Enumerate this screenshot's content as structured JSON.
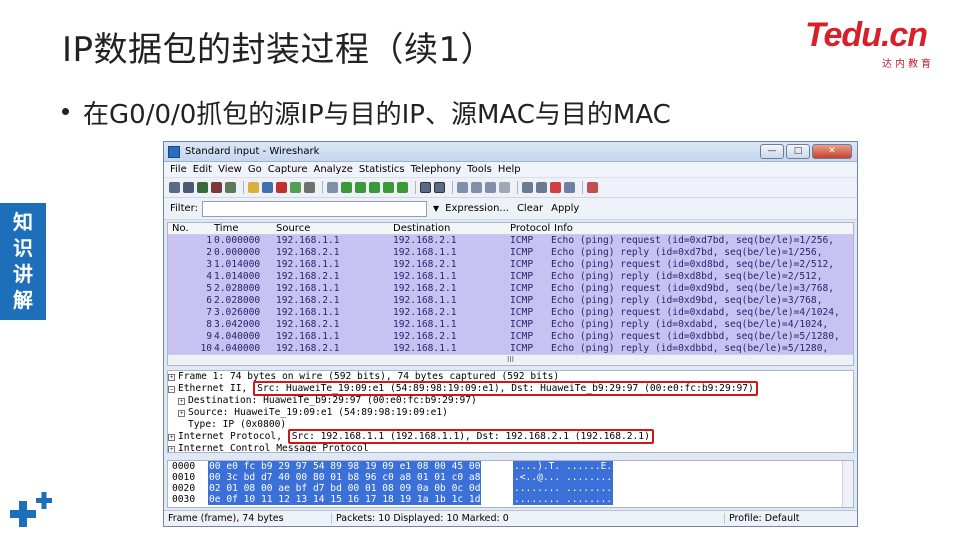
{
  "slide": {
    "title": "IP数据包的封装过程（续1）",
    "bullet": "在G0/0/0抓包的源IP与目的IP、源MAC与目的MAC",
    "side_tab": [
      "知",
      "识",
      "讲",
      "解"
    ],
    "logo_main": "Tedu.cn",
    "logo_sub": "达内教育",
    "accent_color": "#1c6fb8",
    "logo_color": "#d6202a"
  },
  "window": {
    "title": "Standard input - Wireshark",
    "controls": {
      "minimize": "—",
      "maximize": "□",
      "close": "✕"
    },
    "menu": [
      "File",
      "Edit",
      "View",
      "Go",
      "Capture",
      "Analyze",
      "Statistics",
      "Telephony",
      "Tools",
      "Help"
    ],
    "filter": {
      "label": "Filter:",
      "value": "",
      "dropdown": "▼",
      "expression": "Expression...",
      "clear": "Clear",
      "apply": "Apply"
    },
    "packet_list": {
      "columns": [
        "No.",
        "Time",
        "Source",
        "Destination",
        "Protocol",
        "Info"
      ],
      "rows": [
        {
          "no": "1",
          "time": "0.000000",
          "src": "192.168.1.1",
          "dst": "192.168.2.1",
          "proto": "ICMP",
          "info": "Echo (ping) request  (id=0xd7bd, seq(be/le)=1/256,"
        },
        {
          "no": "2",
          "time": "0.000000",
          "src": "192.168.2.1",
          "dst": "192.168.1.1",
          "proto": "ICMP",
          "info": "Echo (ping) reply    (id=0xd7bd, seq(be/le)=1/256,"
        },
        {
          "no": "3",
          "time": "1.014000",
          "src": "192.168.1.1",
          "dst": "192.168.2.1",
          "proto": "ICMP",
          "info": "Echo (ping) request  (id=0xd8bd, seq(be/le)=2/512,"
        },
        {
          "no": "4",
          "time": "1.014000",
          "src": "192.168.2.1",
          "dst": "192.168.1.1",
          "proto": "ICMP",
          "info": "Echo (ping) reply    (id=0xd8bd, seq(be/le)=2/512,"
        },
        {
          "no": "5",
          "time": "2.028000",
          "src": "192.168.1.1",
          "dst": "192.168.2.1",
          "proto": "ICMP",
          "info": "Echo (ping) request  (id=0xd9bd, seq(be/le)=3/768,"
        },
        {
          "no": "6",
          "time": "2.028000",
          "src": "192.168.2.1",
          "dst": "192.168.1.1",
          "proto": "ICMP",
          "info": "Echo (ping) reply    (id=0xd9bd, seq(be/le)=3/768,"
        },
        {
          "no": "7",
          "time": "3.026000",
          "src": "192.168.1.1",
          "dst": "192.168.2.1",
          "proto": "ICMP",
          "info": "Echo (ping) request  (id=0xdabd, seq(be/le)=4/1024,"
        },
        {
          "no": "8",
          "time": "3.042000",
          "src": "192.168.2.1",
          "dst": "192.168.1.1",
          "proto": "ICMP",
          "info": "Echo (ping) reply    (id=0xdabd, seq(be/le)=4/1024,"
        },
        {
          "no": "9",
          "time": "4.040000",
          "src": "192.168.1.1",
          "dst": "192.168.2.1",
          "proto": "ICMP",
          "info": "Echo (ping) request  (id=0xdbbd, seq(be/le)=5/1280,"
        },
        {
          "no": "10",
          "time": "4.040000",
          "src": "192.168.2.1",
          "dst": "192.168.1.1",
          "proto": "ICMP",
          "info": "Echo (ping) reply    (id=0xdbbd, seq(be/le)=5/1280,"
        }
      ],
      "scroll_marker": "III"
    },
    "details": {
      "frame": "Frame 1: 74 bytes on wire (592 bits), 74 bytes captured (592 bits)",
      "ethernet_prefix": "Ethernet II,",
      "ethernet_boxed": "Src: HuaweiTe_19:09:e1 (54:89:98:19:09:e1), Dst: HuaweiTe_b9:29:97 (00:e0:fc:b9:29:97)",
      "eth_dst": "Destination: HuaweiTe_b9:29:97 (00:e0:fc:b9:29:97)",
      "eth_src": "Source: HuaweiTe_19:09:e1 (54:89:98:19:09:e1)",
      "eth_type": "Type: IP (0x0800)",
      "ip_prefix": "Internet Protocol,",
      "ip_boxed": "Src: 192.168.1.1 (192.168.1.1), Dst: 192.168.2.1 (192.168.2.1)",
      "icmp": "Internet Control Message Protocol"
    },
    "hex": [
      {
        "off": "0000",
        "bytes": "00 e0 fc b9 29 97 54 89  98 19 09 e1 08 00 45 00",
        "ascii": "....).T. ......E."
      },
      {
        "off": "0010",
        "bytes": "00 3c bd d7 40 00 80 01  b8 96 c0 a8 01 01 c0 a8",
        "ascii": ".<..@... ........"
      },
      {
        "off": "0020",
        "bytes": "02 01 08 00 ae bf d7 bd  00 01 08 09 0a 0b 0c 0d",
        "ascii": "........ ........"
      },
      {
        "off": "0030",
        "bytes": "0e 0f 10 11 12 13 14 15  16 17 18 19 1a 1b 1c 1d",
        "ascii": "........ ........"
      }
    ],
    "status": {
      "frame": "Frame (frame), 74 bytes",
      "packets": "Packets: 10 Displayed: 10 Marked: 0",
      "profile": "Profile: Default"
    }
  }
}
